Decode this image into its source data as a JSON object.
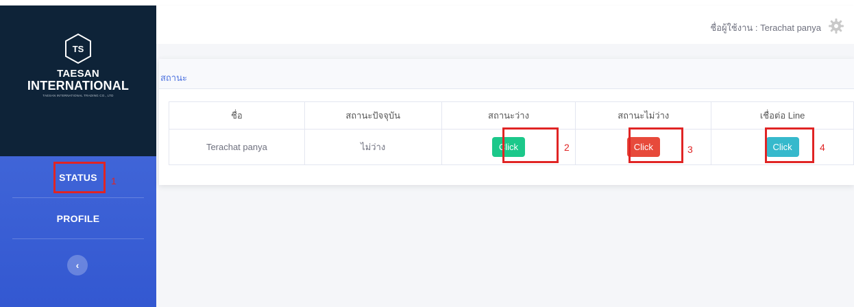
{
  "brand": {
    "logo_text": "TS",
    "name_line1": "TAESAN",
    "name_line2": "INTERNATIONAL",
    "tagline": "TAESAN INTERNATIONAL TRADING CO., LTD"
  },
  "sidebar": {
    "items": [
      {
        "label": "STATUS"
      },
      {
        "label": "PROFILE"
      }
    ],
    "toggle_glyph": "‹"
  },
  "topbar": {
    "user_label": "ชื่อผู้ใช้งาน : Terachat panya"
  },
  "card": {
    "title": "สถานะ"
  },
  "table": {
    "headers": [
      "ชื่อ",
      "สถานะปัจจุบัน",
      "สถานะว่าง",
      "สถานะไม่ว่าง",
      "เชื่อต่อ Line"
    ],
    "row": {
      "name": "Terachat panya",
      "current_status": "ไม่ว่าง",
      "available_button": "Click",
      "busy_button": "Click",
      "line_button": "Click"
    }
  },
  "annotations": [
    "1",
    "2",
    "3",
    "4"
  ],
  "colors": {
    "sidebar": "#4e73df",
    "brand_bg": "#0e2338",
    "highlight": "#e02424",
    "btn_available": "#1cc88a",
    "btn_busy": "#e74a3b",
    "btn_line": "#36b9cc"
  },
  "icons": {
    "logo": "hexagon-logo",
    "settings": "gear-icon",
    "toggle": "chevron-left-icon"
  }
}
